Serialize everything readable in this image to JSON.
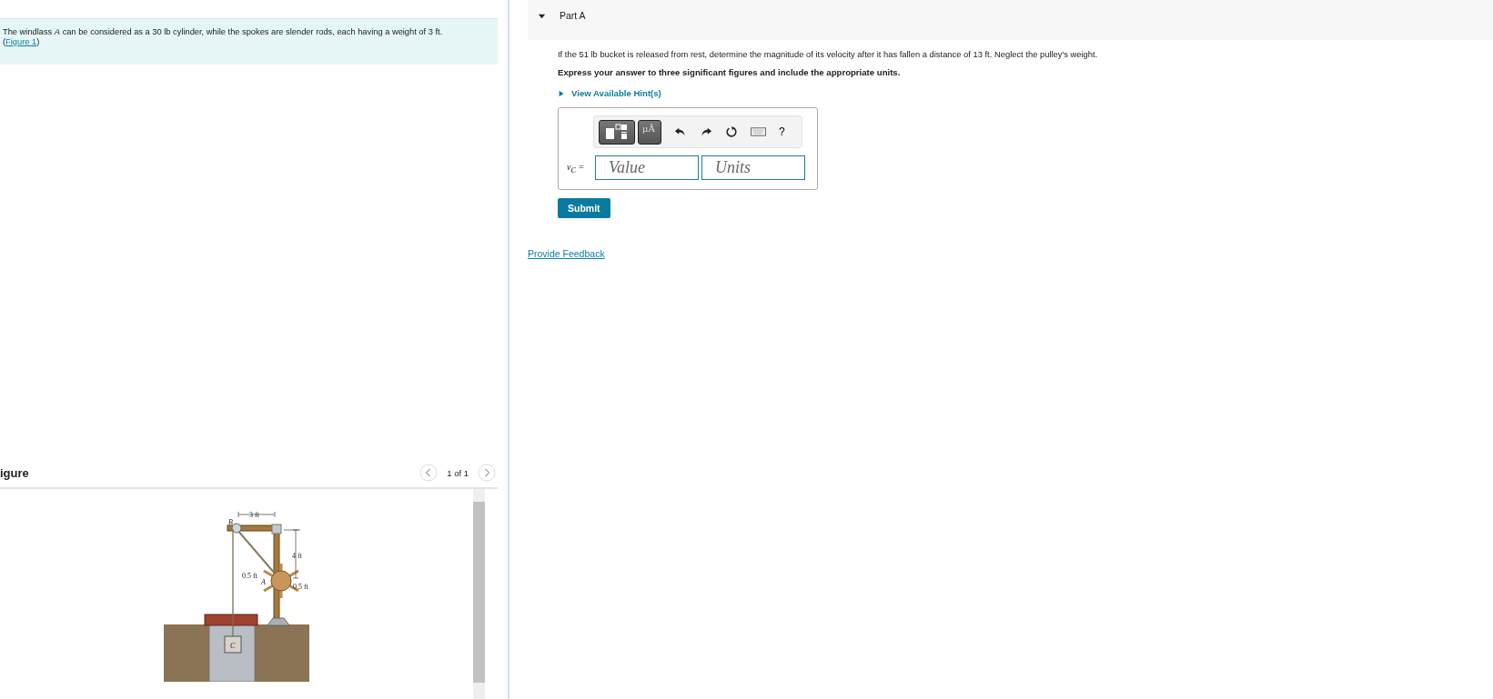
{
  "problem": {
    "text": "The windlass *A* can be considered as a 30 lb cylinder, while the spokes are slender rods, each having a weight of 3 ft.",
    "link_open": "(",
    "link": "Figure 1",
    "link_close": ")"
  },
  "figure": {
    "heading": "igure",
    "pager": "1 of 1",
    "labels": {
      "b": "B",
      "span": "3 ft",
      "height": "4 ft",
      "radius_left": "0.5 ft",
      "a": "A",
      "radius_right": "0.5 ft",
      "c": "C"
    }
  },
  "part": {
    "title": "Part A",
    "expanded": true,
    "question": "If the 51 lb bucket is released from rest, determine the magnitude of its velocity after it has fallen a distance of 13 ft. Neglect the pulley's weight.",
    "instruction": "Express your answer to three significant figures and include the appropriate units.",
    "hints": "View Available Hint(s)",
    "toolbar": [
      {
        "kind": "templates"
      },
      {
        "kind": "symbols",
        "text": "µÅ"
      },
      {
        "kind": "undo"
      },
      {
        "kind": "redo"
      },
      {
        "kind": "reset"
      },
      {
        "kind": "keyboard"
      },
      {
        "kind": "help",
        "text": "?"
      }
    ],
    "answer_label": "v$_{C}$ =",
    "value_placeholder": "Value",
    "units_placeholder": "Units",
    "submit": "Submit"
  },
  "feedback": "Provide Feedback"
}
